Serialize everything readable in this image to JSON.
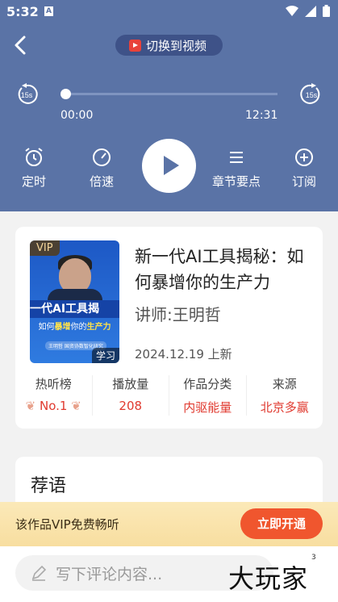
{
  "status_bar": {
    "time": "5:32",
    "notification_icon": "A"
  },
  "header": {
    "back_icon": "chevron-left-icon",
    "switch_label": "切换到视频"
  },
  "player": {
    "current_time": "00:00",
    "duration": "12:31",
    "progress": 0,
    "skip_back_label": "15s",
    "skip_forward_label": "15s",
    "controls": {
      "timer": "定时",
      "speed": "倍速",
      "chapters": "章节要点",
      "subscribe": "订阅"
    }
  },
  "work": {
    "vip_badge": "VIP",
    "cover_title": "一代AI工具揭",
    "cover_sub_pre": "如何",
    "cover_sub_highlight": "暴增",
    "cover_sub_mid": "你的",
    "cover_sub_highlight2": "生产力",
    "cover_tag": "王明哲  国资协数智化研究",
    "study_tag": "学习",
    "title": "新一代AI工具揭秘：如何暴增你的生产力",
    "teacher": "讲师:王明哲",
    "date": "2024.12.19 上新",
    "stats": [
      {
        "label": "热听榜",
        "value": "No.1"
      },
      {
        "label": "播放量",
        "value": "208"
      },
      {
        "label": "作品分类",
        "value": "内驱能量"
      },
      {
        "label": "来源",
        "value": "北京多赢"
      }
    ]
  },
  "recommend": {
    "title": "荐语"
  },
  "vip_bar": {
    "text": "该作品VIP免费畅听",
    "button": "立即开通"
  },
  "comment": {
    "placeholder": "写下评论内容..."
  },
  "watermark": {
    "text": "大玩家",
    "small": "3"
  },
  "colors": {
    "header_bg": "#5a73a6",
    "accent_red": "#e03a2f",
    "vip_button": "#f0562e"
  }
}
